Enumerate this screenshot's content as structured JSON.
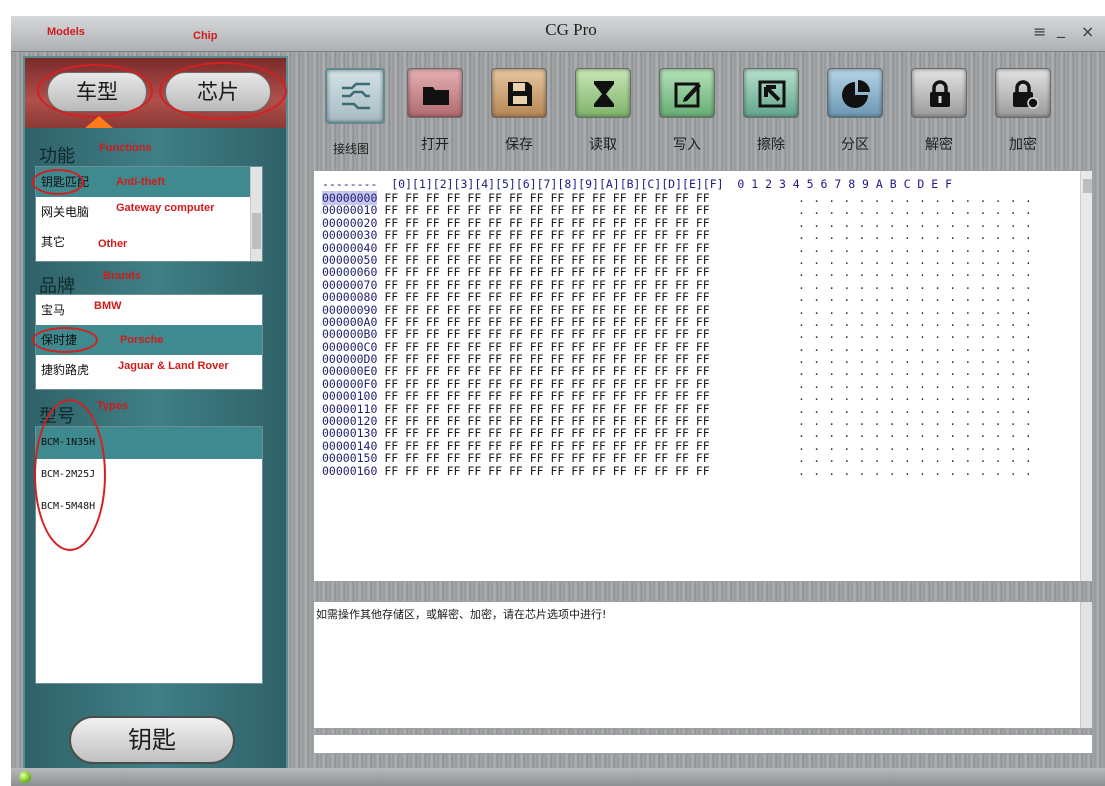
{
  "window": {
    "title": "CG Pro",
    "models_caption": "Models",
    "chip_caption": "Chip",
    "menu_glyph": "≡",
    "minimize_glyph": "_",
    "close_glyph": "×"
  },
  "left": {
    "tabs": [
      {
        "label": "车型",
        "selected": true
      },
      {
        "label": "芯片",
        "selected": false
      }
    ],
    "functions": {
      "title": "功能",
      "title_en": "Functions",
      "items": [
        {
          "label": "钥匙匹配",
          "en": "Anti-theft",
          "selected": true
        },
        {
          "label": "网关电脑",
          "en": "Gateway computer",
          "selected": false
        },
        {
          "label": "其它",
          "en": "Other",
          "selected": false
        }
      ]
    },
    "brands": {
      "title": "品牌",
      "title_en": "Brands",
      "items": [
        {
          "label": "宝马",
          "en": "BMW",
          "selected": false
        },
        {
          "label": "保时捷",
          "en": "Porsche",
          "selected": true
        },
        {
          "label": "捷豹路虎",
          "en": "Jaguar & Land Rover",
          "selected": false
        }
      ]
    },
    "types": {
      "title": "型号",
      "title_en": "Types",
      "items": [
        {
          "label": "BCM-1N35H",
          "selected": true
        },
        {
          "label": "BCM-2M25J",
          "selected": false
        },
        {
          "label": "BCM-5M48H",
          "selected": false
        }
      ]
    },
    "key_button": "钥匙"
  },
  "toolbar": {
    "items": [
      {
        "label": "接线图",
        "icon": "wiring-diagram-icon"
      },
      {
        "label": "打开",
        "icon": "folder-icon"
      },
      {
        "label": "保存",
        "icon": "floppy-disk-icon"
      },
      {
        "label": "读取",
        "icon": "hourglass-icon"
      },
      {
        "label": "写入",
        "icon": "pencil-icon"
      },
      {
        "label": "擦除",
        "icon": "eraser-icon"
      },
      {
        "label": "分区",
        "icon": "pie-chart-icon"
      },
      {
        "label": "解密",
        "icon": "padlock-icon"
      },
      {
        "label": "加密",
        "icon": "lock-gear-icon"
      }
    ]
  },
  "hex": {
    "header": "--------  [0][1][2][3][4][5][6][7][8][9][A][B][C][D][E][F]  0 1 2 3 4 5 6 7 8 9 A B C D E F",
    "rows": [
      "00000000",
      "00000010",
      "00000020",
      "00000030",
      "00000040",
      "00000050",
      "00000060",
      "00000070",
      "00000080",
      "00000090",
      "000000A0",
      "000000B0",
      "000000C0",
      "000000D0",
      "000000E0",
      "000000F0",
      "00000100",
      "00000110",
      "00000120",
      "00000130",
      "00000140",
      "00000150",
      "00000160"
    ],
    "byte_value": "FF",
    "ascii_char": "."
  },
  "message": "如需操作其他存储区，或解密、加密，请在芯片选项中进行!",
  "colors": {
    "annotation_red": "#d11a1a",
    "selection_teal": "#3f8a8f",
    "panel_teal": "#3f7f86"
  }
}
